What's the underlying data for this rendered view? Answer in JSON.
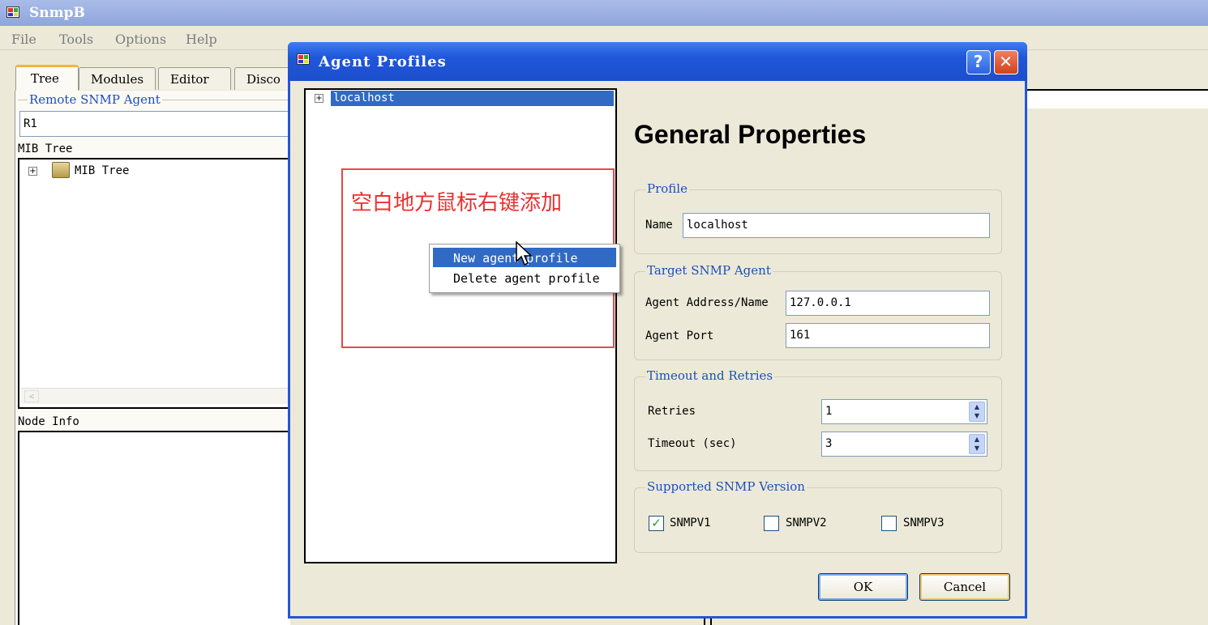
{
  "app": {
    "title": "SnmpB"
  },
  "menu": [
    "File",
    "Tools",
    "Options",
    "Help"
  ],
  "tabs": [
    "Tree",
    "Modules",
    "Editor",
    "Disco"
  ],
  "left_panel": {
    "remote_agent_legend": "Remote SNMP Agent",
    "agent_value": "R1",
    "mib_tree_label": "MIB Tree",
    "mib_tree_root": "MIB Tree",
    "node_info_label": "Node Info"
  },
  "dialog": {
    "title": "Agent Profiles",
    "help_glyph": "?",
    "close_glyph": "✕",
    "tree_item": "localhost",
    "heading": "General Properties",
    "profile_legend": "Profile",
    "name_label": "Name",
    "name_value": "localhost",
    "target_legend": "Target SNMP Agent",
    "address_label": "Agent Address/Name",
    "address_value": "127.0.0.1",
    "port_label": "Agent Port",
    "port_value": "161",
    "timeout_legend": "Timeout and Retries",
    "retries_label": "Retries",
    "retries_value": "1",
    "timeout_label": "Timeout (sec)",
    "timeout_value": "3",
    "version_legend": "Supported SNMP Version",
    "versions": [
      {
        "label": "SNMPV1",
        "checked": true
      },
      {
        "label": "SNMPV2",
        "checked": false
      },
      {
        "label": "SNMPV3",
        "checked": false
      }
    ],
    "ok_label": "OK",
    "cancel_label": "Cancel"
  },
  "context_menu": {
    "new_profile": "New agent profile",
    "delete_profile": "Delete agent profile"
  },
  "annotation": "空白地方鼠标右键添加",
  "colors": {
    "annotation": "#e8312f",
    "title_bar": "#1f56d9",
    "highlight": "#316ac5",
    "legend": "#1c4fbf"
  }
}
